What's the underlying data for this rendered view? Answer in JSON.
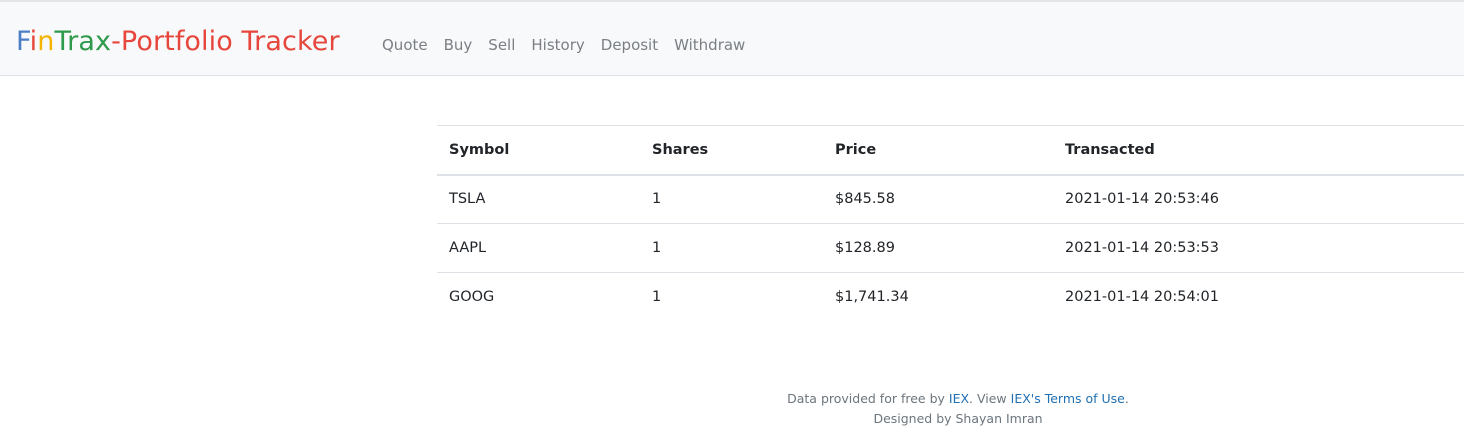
{
  "brand": {
    "part1": "F",
    "part2": "i",
    "part3": "n",
    "part4": "Trax",
    "part5": "-Portfolio Tracker"
  },
  "nav": {
    "items": [
      "Quote",
      "Buy",
      "Sell",
      "History",
      "Deposit",
      "Withdraw"
    ]
  },
  "history_table": {
    "headers": [
      "Symbol",
      "Shares",
      "Price",
      "Transacted"
    ],
    "rows": [
      [
        "TSLA",
        "1",
        "$845.58",
        "2021-01-14 20:53:46"
      ],
      [
        "AAPL",
        "1",
        "$128.89",
        "2021-01-14 20:53:53"
      ],
      [
        "GOOG",
        "1",
        "$1,741.34",
        "2021-01-14 20:54:01"
      ]
    ]
  },
  "footer": {
    "line1_prefix": "Data provided for free by ",
    "iex_link": "IEX",
    "line1_mid": ". View ",
    "terms_link": "IEX's Terms of Use",
    "line1_suffix": ".",
    "line2": "Designed by Shayan Imran"
  },
  "colors": {
    "brand_blue": "#4a7fc6",
    "brand_red": "#e6463c",
    "brand_yellow": "#f5b400",
    "brand_green": "#2e9a4c",
    "link": "#1f6fb2"
  }
}
